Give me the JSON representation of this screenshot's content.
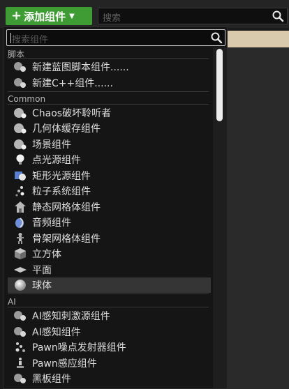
{
  "toolbar": {
    "add_component_label": "添加组件",
    "search_placeholder": "搜索"
  },
  "menu": {
    "search_placeholder": "搜索组件",
    "categories": [
      {
        "name": "脚本",
        "items": [
          {
            "label": "新建蓝图脚本组件......",
            "icon": "blueprint-script-icon"
          },
          {
            "label": "新建C++组件......",
            "icon": "cpp-component-icon"
          }
        ]
      },
      {
        "name": "Common",
        "items": [
          {
            "label": "Chaos破坏聆听者",
            "icon": "chaos-listener-icon"
          },
          {
            "label": "几何体缓存组件",
            "icon": "geometry-cache-icon"
          },
          {
            "label": "场景组件",
            "icon": "scene-component-icon"
          },
          {
            "label": "点光源组件",
            "icon": "point-light-icon"
          },
          {
            "label": "矩形光源组件",
            "icon": "rect-light-icon"
          },
          {
            "label": "粒子系统组件",
            "icon": "particle-system-icon"
          },
          {
            "label": "静态网格体组件",
            "icon": "static-mesh-icon"
          },
          {
            "label": "音频组件",
            "icon": "audio-icon"
          },
          {
            "label": "骨架网格体组件",
            "icon": "skeletal-mesh-icon"
          },
          {
            "label": "立方体",
            "icon": "cube-icon"
          },
          {
            "label": "平面",
            "icon": "plane-icon"
          },
          {
            "label": "球体",
            "icon": "sphere-icon",
            "selected": true
          }
        ]
      },
      {
        "name": "AI",
        "items": [
          {
            "label": "AI感知刺激源组件",
            "icon": "ai-stimuli-source-icon"
          },
          {
            "label": "AI感知组件",
            "icon": "ai-perception-icon"
          },
          {
            "label": "Pawn噪点发射器组件",
            "icon": "pawn-noise-emitter-icon"
          },
          {
            "label": "Pawn感应组件",
            "icon": "pawn-sensing-icon"
          },
          {
            "label": "黑板组件",
            "icon": "blackboard-icon"
          }
        ]
      }
    ]
  }
}
